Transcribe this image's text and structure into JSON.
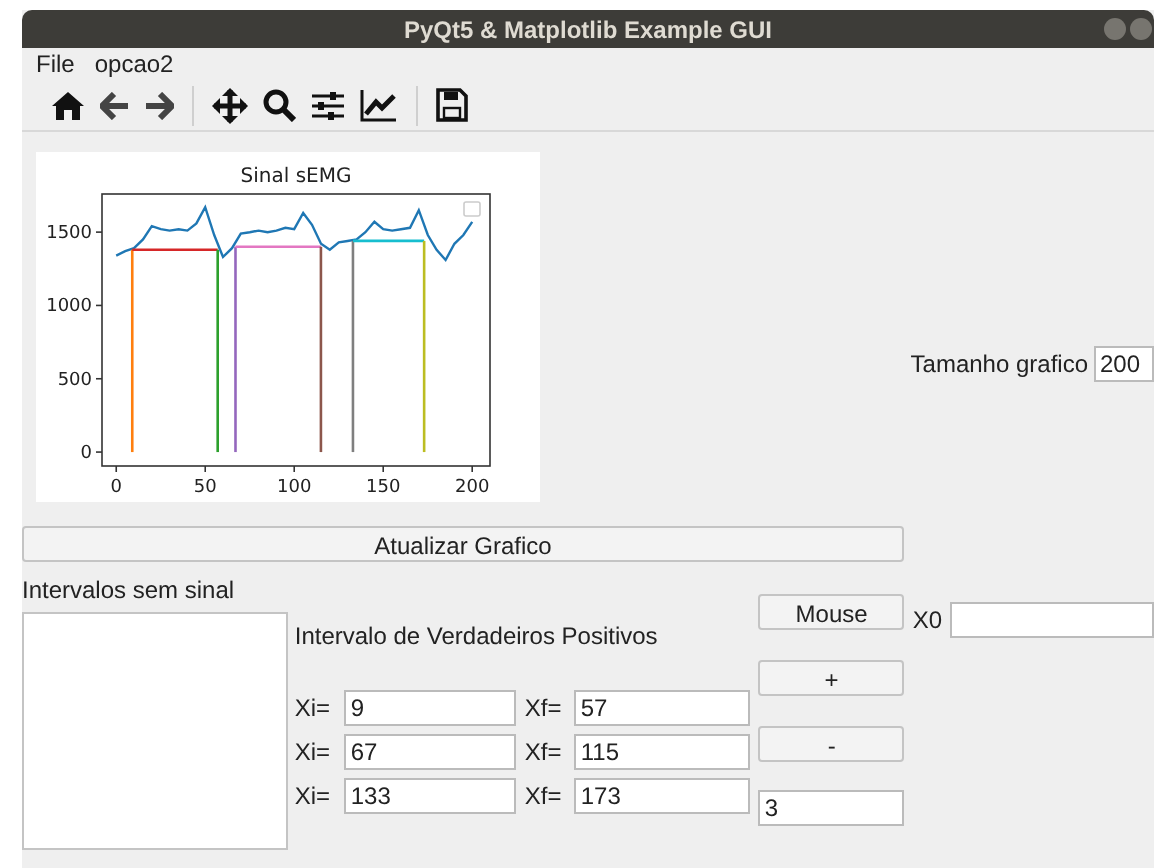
{
  "window": {
    "title": "PyQt5 & Matplotlib Example GUI"
  },
  "menu": [
    {
      "label": "File"
    },
    {
      "label": "opcao2"
    }
  ],
  "chart": {
    "chart_data": {
      "type": "line",
      "title": "Sinal sEMG",
      "xlim": [
        -8,
        210
      ],
      "ylim": [
        -95,
        1760
      ],
      "xticks": [
        0,
        50,
        100,
        150,
        200
      ],
      "yticks": [
        0,
        500,
        1000,
        1500
      ],
      "x": [
        0,
        5,
        10,
        15,
        20,
        25,
        30,
        35,
        40,
        45,
        50,
        55,
        60,
        65,
        70,
        75,
        80,
        85,
        90,
        95,
        100,
        105,
        110,
        115,
        120,
        125,
        130,
        135,
        140,
        145,
        150,
        155,
        160,
        165,
        170,
        175,
        180,
        185,
        190,
        195,
        200
      ],
      "series": [
        {
          "color": "#1f77b4",
          "values": [
            1340,
            1370,
            1390,
            1450,
            1540,
            1520,
            1510,
            1520,
            1510,
            1560,
            1670,
            1480,
            1330,
            1390,
            1490,
            1500,
            1510,
            1500,
            1510,
            1530,
            1520,
            1630,
            1550,
            1420,
            1380,
            1430,
            1440,
            1450,
            1500,
            1570,
            1520,
            1510,
            1520,
            1530,
            1650,
            1480,
            1380,
            1310,
            1420,
            1480,
            1570
          ]
        }
      ],
      "ref_lines": [
        {
          "axis": "x",
          "value": 9,
          "color": "#ff7f0e"
        },
        {
          "axis": "y",
          "value": 1380,
          "color": "#d62728"
        },
        {
          "axis": "x",
          "value": 57,
          "color": "#2ca02c"
        },
        {
          "axis": "x",
          "value": 67,
          "color": "#9467bd"
        },
        {
          "axis": "y",
          "value": 1400,
          "color": "#e377c2"
        },
        {
          "axis": "x",
          "value": 115,
          "color": "#8c564b"
        },
        {
          "axis": "x",
          "value": 133,
          "color": "#7f7f7f"
        },
        {
          "axis": "y",
          "value": 1440,
          "color": "#17becf"
        },
        {
          "axis": "x",
          "value": 173,
          "color": "#bcbd22"
        }
      ]
    }
  },
  "size_field": {
    "label": "Tamanho grafico",
    "value": "200"
  },
  "update_button": {
    "label": "Atualizar Grafico"
  },
  "no_signal": {
    "label": "Intervalos sem sinal"
  },
  "true_positives": {
    "label": "Intervalo de Verdadeiros Positivos",
    "rows": [
      {
        "xi_label": "Xi=",
        "xi": "9",
        "xf_label": "Xf=",
        "xf": "57"
      },
      {
        "xi_label": "Xi=",
        "xi": "67",
        "xf_label": "Xf=",
        "xf": "115"
      },
      {
        "xi_label": "Xi=",
        "xi": "133",
        "xf_label": "Xf=",
        "xf": "173"
      }
    ]
  },
  "buttons": {
    "mouse": "Mouse",
    "plus": "+",
    "minus": "-",
    "count": "3"
  },
  "x0_field": {
    "label": "X0"
  }
}
